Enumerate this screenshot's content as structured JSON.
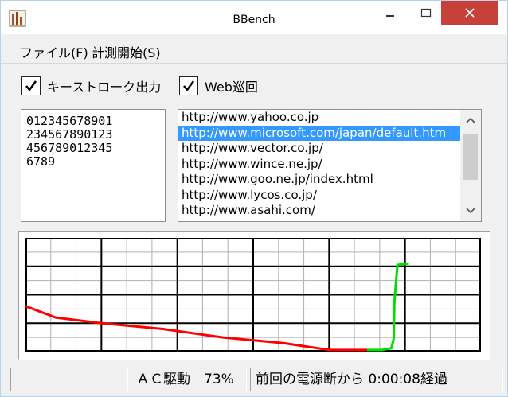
{
  "window": {
    "title": "BBench"
  },
  "menu": {
    "items": [
      "ファイル(F)",
      "計測開始(S)"
    ]
  },
  "options": {
    "keystroke_label": "キーストローク出力",
    "keystroke_checked": true,
    "web_label": "Web巡回",
    "web_checked": true
  },
  "keystroke_lines": [
    "012345678901",
    "234567890123",
    "456789012345",
    "6789"
  ],
  "url_list": {
    "items": [
      "http://www.yahoo.co.jp",
      "http://www.microsoft.com/japan/default.htm",
      "http://www.vector.co.jp/",
      "http://www.wince.ne.jp/",
      "http://www.goo.ne.jp/index.html",
      "http://www.lycos.co.jp/",
      "http://www.asahi.com/"
    ],
    "selected_index": 1
  },
  "chart_data": {
    "type": "line",
    "grid": true,
    "x_divisions": 6,
    "y_divisions": 4,
    "series": [
      {
        "color": "#ff0000",
        "points": [
          [
            0,
            1.6
          ],
          [
            0.4,
            1.2
          ],
          [
            1,
            1.0
          ],
          [
            1.8,
            0.8
          ],
          [
            2.6,
            0.5
          ],
          [
            3.4,
            0.3
          ],
          [
            4,
            0.06
          ],
          [
            4.5,
            0.06
          ]
        ]
      },
      {
        "color": "#00dd00",
        "points": [
          [
            4.5,
            0.06
          ],
          [
            4.7,
            0.06
          ],
          [
            4.82,
            0.12
          ],
          [
            4.85,
            0.45
          ],
          [
            4.86,
            1.75
          ],
          [
            4.9,
            3.05
          ],
          [
            5.05,
            3.1
          ]
        ]
      }
    ]
  },
  "status": {
    "power": "ＡＣ駆動　73%",
    "elapsed": "前回の電源断から 0:00:08経過"
  },
  "colors": {
    "selection": "#3399ff",
    "close_button": "#c7403a",
    "battery_line": "#ff0000",
    "charging_line": "#00dd00"
  }
}
